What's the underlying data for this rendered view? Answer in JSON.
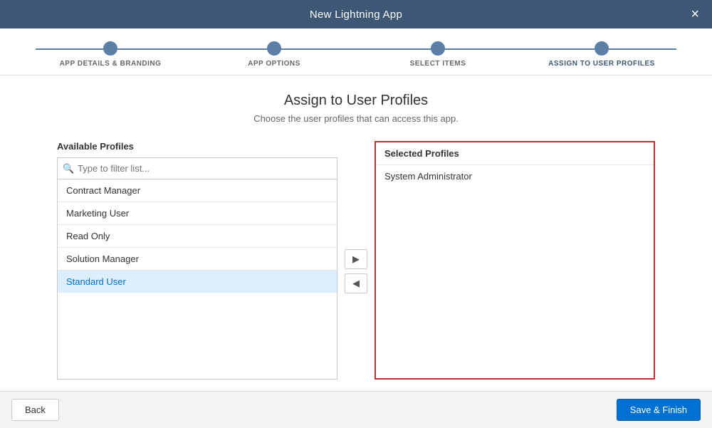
{
  "titleBar": {
    "title": "New Lightning App",
    "closeLabel": "×"
  },
  "stepper": {
    "steps": [
      {
        "id": "app-details",
        "label": "APP DETAILS & BRANDING",
        "active": false
      },
      {
        "id": "app-options",
        "label": "APP OPTIONS",
        "active": false
      },
      {
        "id": "select-items",
        "label": "SELECT ITEMS",
        "active": false
      },
      {
        "id": "assign-profiles",
        "label": "ASSIGN TO USER PROFILES",
        "active": true
      }
    ]
  },
  "page": {
    "title": "Assign to User Profiles",
    "subtitle": "Choose the user profiles that can access this app."
  },
  "availableProfiles": {
    "panelTitle": "Available Profiles",
    "filterPlaceholder": "Type to filter list...",
    "items": [
      {
        "id": "contract-manager",
        "label": "Contract Manager",
        "selected": false
      },
      {
        "id": "marketing-user",
        "label": "Marketing User",
        "selected": false
      },
      {
        "id": "read-only",
        "label": "Read Only",
        "selected": false
      },
      {
        "id": "solution-manager",
        "label": "Solution Manager",
        "selected": false
      },
      {
        "id": "standard-user",
        "label": "Standard User",
        "selected": true
      }
    ]
  },
  "arrows": {
    "moveRight": "▶",
    "moveLeft": "◀"
  },
  "selectedProfiles": {
    "panelTitle": "Selected Profiles",
    "items": [
      {
        "id": "system-admin",
        "label": "System Administrator"
      }
    ]
  },
  "footer": {
    "backLabel": "Back",
    "saveLabel": "Save & Finish"
  }
}
